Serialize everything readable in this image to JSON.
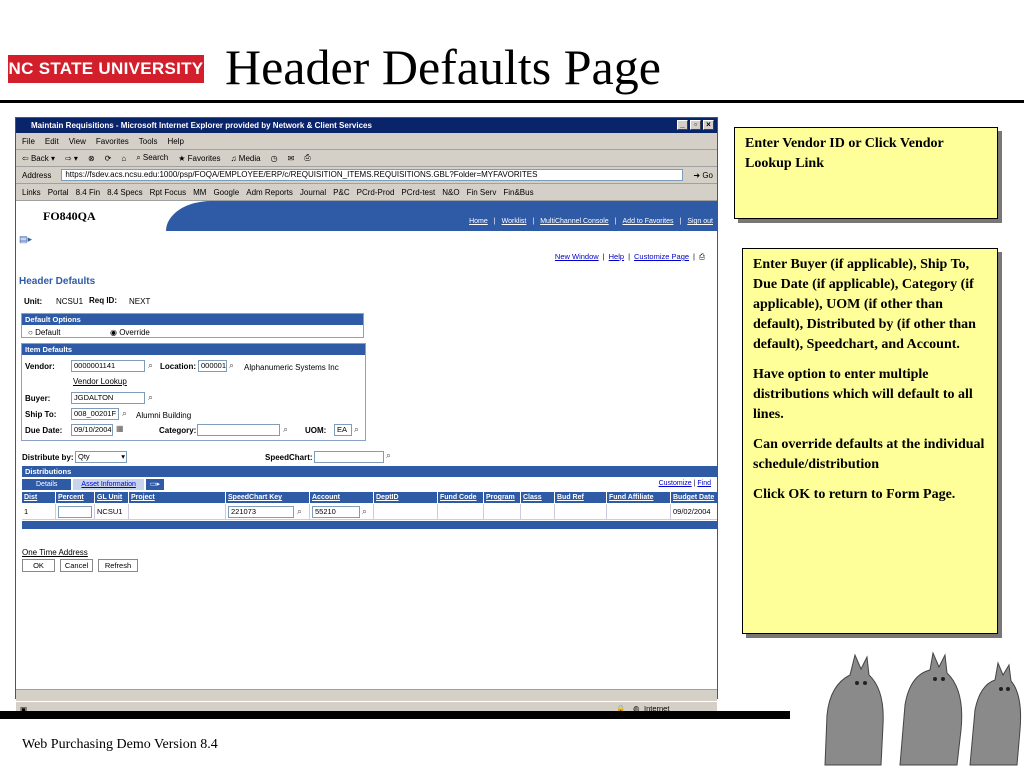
{
  "slide": {
    "title": "Header Defaults Page",
    "logo": "NC STATE UNIVERSITY",
    "footer": "Web Purchasing Demo Version 8.4"
  },
  "notes": {
    "box1": "Enter Vendor ID or Click Vendor Lookup Link",
    "box2": [
      "Enter Buyer (if applicable), Ship To, Due Date (if applicable), Category (if applicable), UOM (if other than default), Distributed by (if other than default), Speedchart, and Account.",
      "Have option to enter multiple distributions which will default to all lines.",
      "Can override defaults at the individual schedule/distribution",
      "Click OK to return to Form Page."
    ]
  },
  "browser": {
    "title": "Maintain Requisitions - Microsoft Internet Explorer provided by Network & Client Services",
    "menu": [
      "File",
      "Edit",
      "View",
      "Favorites",
      "Tools",
      "Help"
    ],
    "toolbar": {
      "back": "Back",
      "search": "Search",
      "favorites": "Favorites",
      "media": "Media"
    },
    "address_label": "Address",
    "address": "https://fsdev.acs.ncsu.edu:1000/psp/FOQA/EMPLOYEE/ERP/c/REQUISITION_ITEMS.REQUISITIONS.GBL?Folder=MYFAVORITES",
    "go": "Go",
    "links_label": "Links",
    "links": [
      "Portal",
      "8.4 Fin",
      "8.4 Specs",
      "Rpt Focus",
      "MM",
      "Google",
      "Adm Reports",
      "Journal",
      "P&C",
      "PCrd-Prod",
      "PCrd-test",
      "N&O",
      "Fin Serv",
      "Fin&Bus"
    ],
    "status": "Internet"
  },
  "app": {
    "db": "FO840QA",
    "header_links": [
      "Home",
      "Worklist",
      "MultiChannel Console",
      "Add to Favorites",
      "Sign out"
    ],
    "top_links": [
      "New Window",
      "Help",
      "Customize Page"
    ],
    "page_title": "Header Defaults",
    "unit_label": "Unit:",
    "unit": "NCSU1",
    "req_label": "Req ID:",
    "req": "NEXT",
    "default_options": {
      "title": "Default Options",
      "default": "Default",
      "override": "Override"
    },
    "item_defaults": {
      "title": "Item Defaults",
      "vendor_label": "Vendor:",
      "vendor": "0000001141",
      "location_label": "Location:",
      "location": "000001",
      "vendor_name": "Alphanumeric Systems Inc",
      "vendor_lookup": "Vendor Lookup",
      "buyer_label": "Buyer:",
      "buyer": "JGDALTON",
      "ship_label": "Ship To:",
      "ship": "008_00201F",
      "ship_name": "Alumni Building",
      "due_label": "Due Date:",
      "due": "09/10/2004",
      "category_label": "Category:",
      "uom_label": "UOM:",
      "uom": "EA"
    },
    "distribute_label": "Distribute by:",
    "distribute": "Qty",
    "speedchart_label": "SpeedChart:",
    "distributions": {
      "title": "Distributions",
      "customize": "Customize",
      "find": "Find",
      "tabs": [
        "Details",
        "Asset Information"
      ],
      "columns": [
        "Dist",
        "Percent",
        "GL Unit",
        "Project",
        "SpeedChart Key",
        "Account",
        "DeptID",
        "Fund Code",
        "Program",
        "Class",
        "Bud Ref",
        "Fund Affiliate",
        "Budget Date"
      ],
      "row": {
        "dist": "1",
        "gl_unit": "NCSU1",
        "speedchart_key": "221073",
        "account": "55210",
        "budget_date": "09/02/2004"
      }
    },
    "one_time": "One Time Address",
    "buttons": {
      "ok": "OK",
      "cancel": "Cancel",
      "refresh": "Refresh"
    }
  }
}
